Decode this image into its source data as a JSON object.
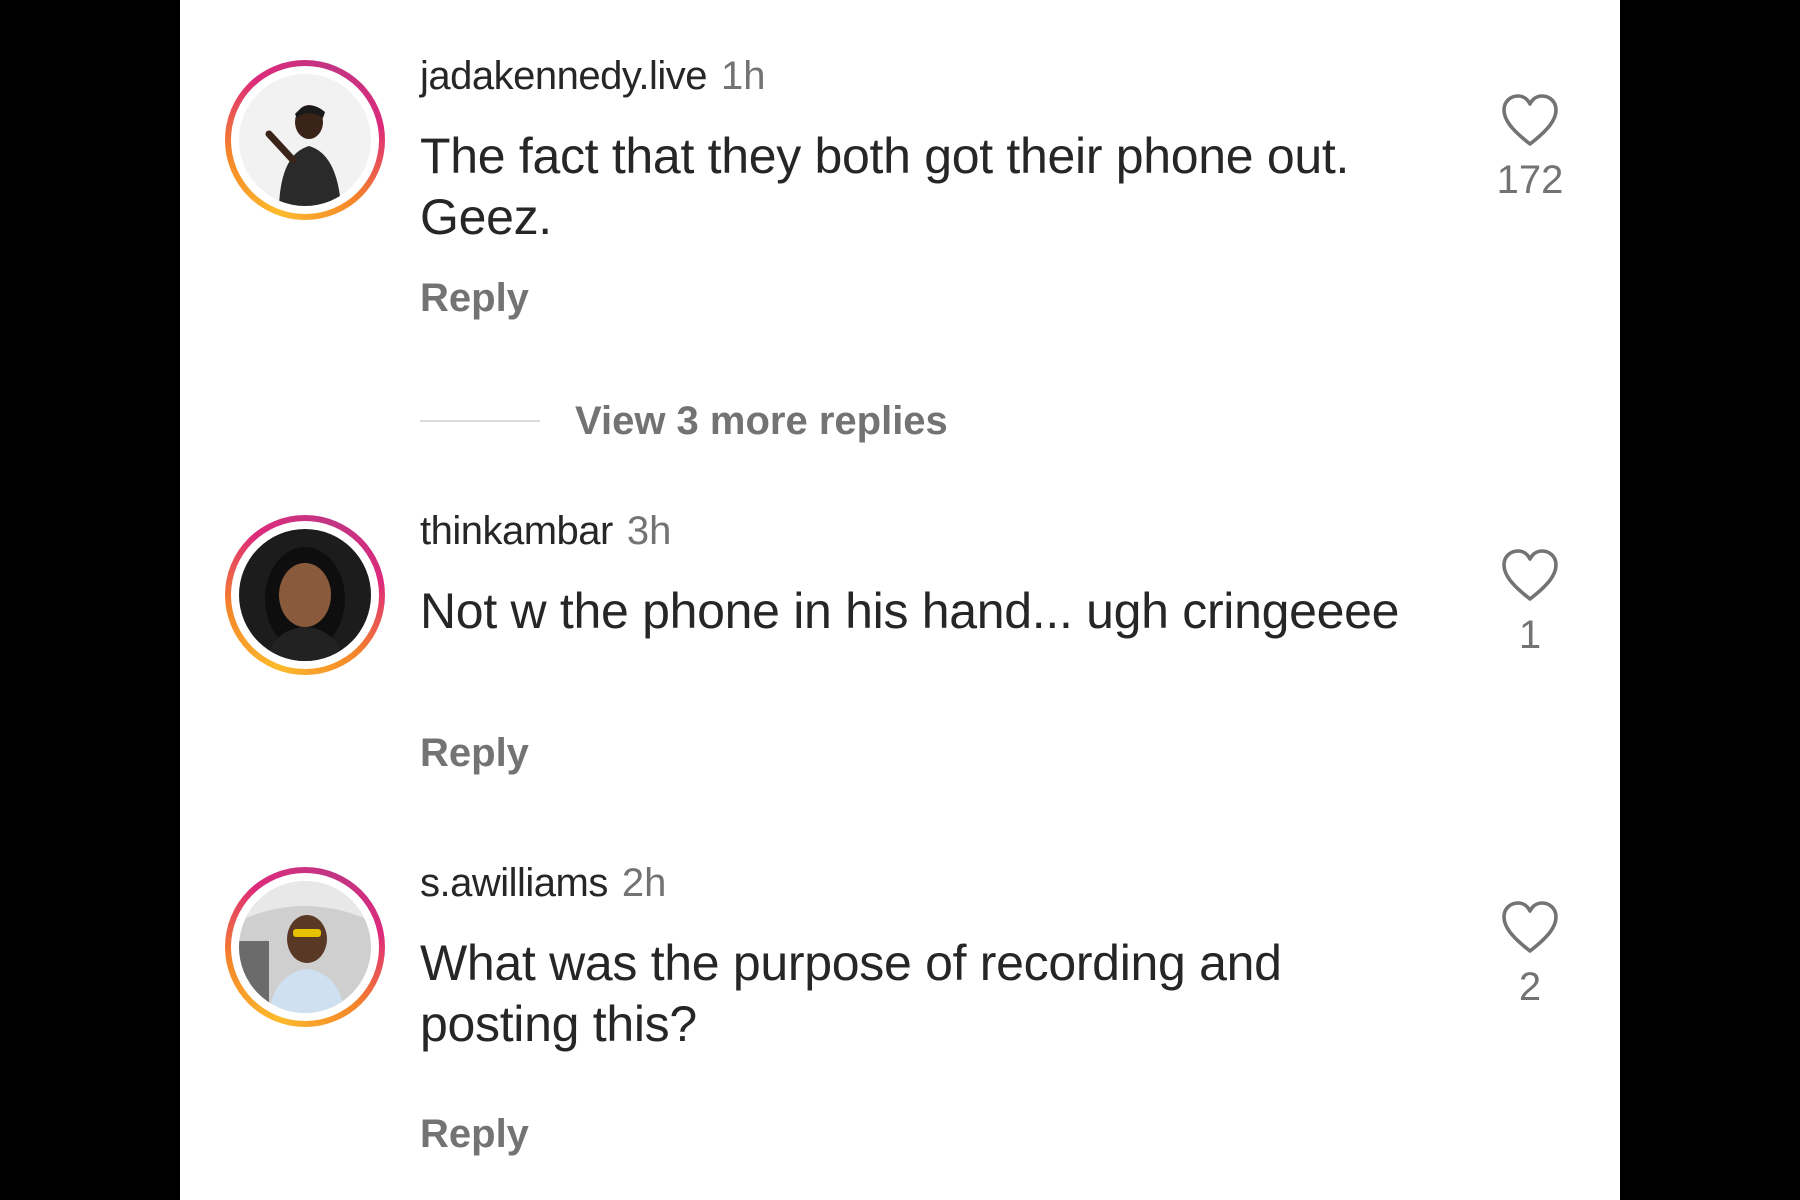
{
  "comments": [
    {
      "username": "jadakennedy.live",
      "time": "1h",
      "text": "The fact that they both got their phone out. Geez.",
      "reply_label": "Reply",
      "like_count": "172"
    },
    {
      "username": "thinkambar",
      "time": "3h",
      "text": "Not w the phone in his hand... ugh cringeeee",
      "reply_label": "Reply",
      "like_count": "1"
    },
    {
      "username": "s.awilliams",
      "time": "2h",
      "text": "What was the purpose of recording and posting this?",
      "reply_label": "Reply",
      "like_count": "2"
    }
  ],
  "view_more_replies": "View 3 more replies",
  "icons": {
    "like": "heart-outline-icon",
    "avatar": "story-ring-avatar"
  },
  "colors": {
    "text_primary": "#262626",
    "text_secondary": "#737373",
    "divider": "#dbdbdb",
    "story_ring_start": "#f58529",
    "story_ring_end": "#dd2a7b"
  }
}
